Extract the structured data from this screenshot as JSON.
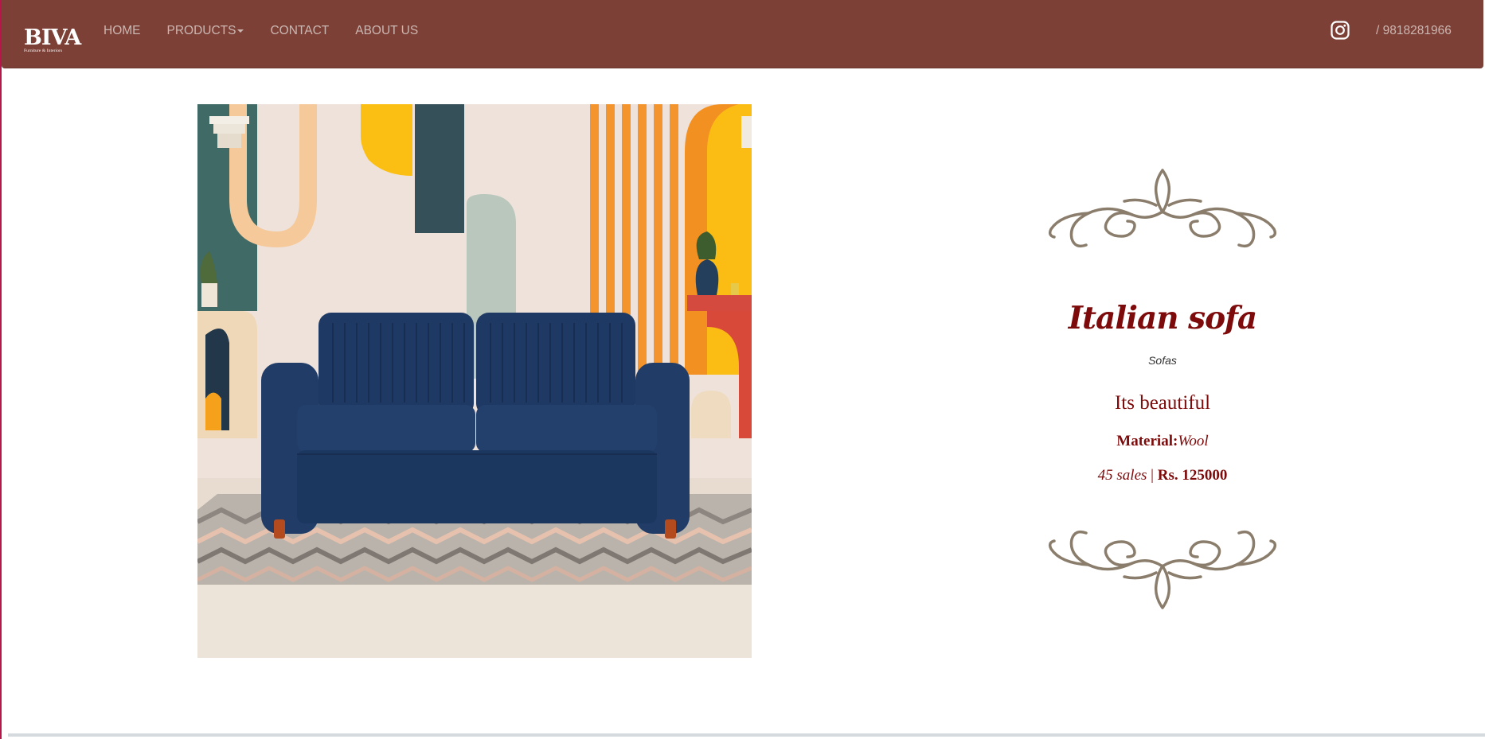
{
  "brand": {
    "name": "BIVA",
    "tagline": "Furniture & Interiors"
  },
  "nav": {
    "items": [
      {
        "label": "HOME"
      },
      {
        "label": "PRODUCTS"
      },
      {
        "label": "CONTACT"
      },
      {
        "label": "ABOUT US"
      }
    ],
    "phone": "/ 9818281966"
  },
  "icons": {
    "instagram": "instagram-icon",
    "products_dropdown": "caret-down-icon",
    "flourish": "ornament-flourish-icon"
  },
  "product": {
    "name": "Italian sofa",
    "category": "Sofas",
    "description": "Its beautiful",
    "material_label": "Material:",
    "material_value": "Wool",
    "sales": "45 sales",
    "separator": "|",
    "price": "Rs. 125000"
  },
  "colors": {
    "navbar": "#7d4036",
    "nav_text": "#cbb7b2",
    "product_text": "#7e0b0b",
    "ornament": "#8b7d6b",
    "sofa": "#1f3a63"
  }
}
